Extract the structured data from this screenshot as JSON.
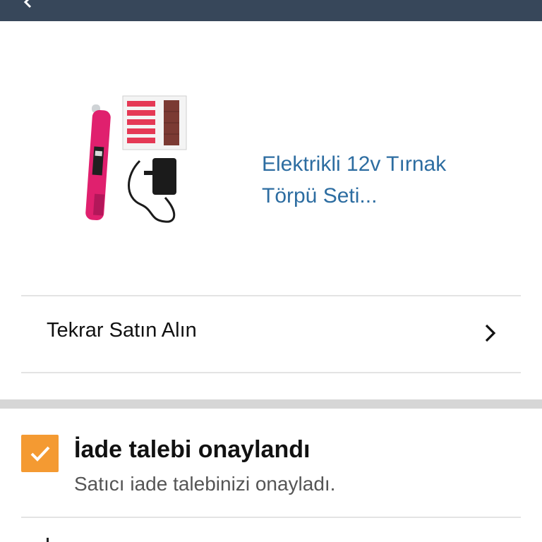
{
  "header": {
    "bar_color": "#37475a",
    "back_icon": "chevron-left-icon"
  },
  "product": {
    "title": "Elektrikli 12v Tırnak Törpü Seti...",
    "image_icon": "nail-drill-kit-image"
  },
  "actions": {
    "rebuy_label": "Tekrar Satın Alın",
    "rebuy_icon": "chevron-right-icon"
  },
  "status": {
    "title": "İade talebi onaylandı",
    "subtitle": "Satıcı iade talebinizi onayladı.",
    "icon": "checkmark-icon",
    "accent": "#f49a32"
  },
  "colors": {
    "link": "#2d6da1",
    "text": "#111111",
    "muted": "#555555"
  }
}
